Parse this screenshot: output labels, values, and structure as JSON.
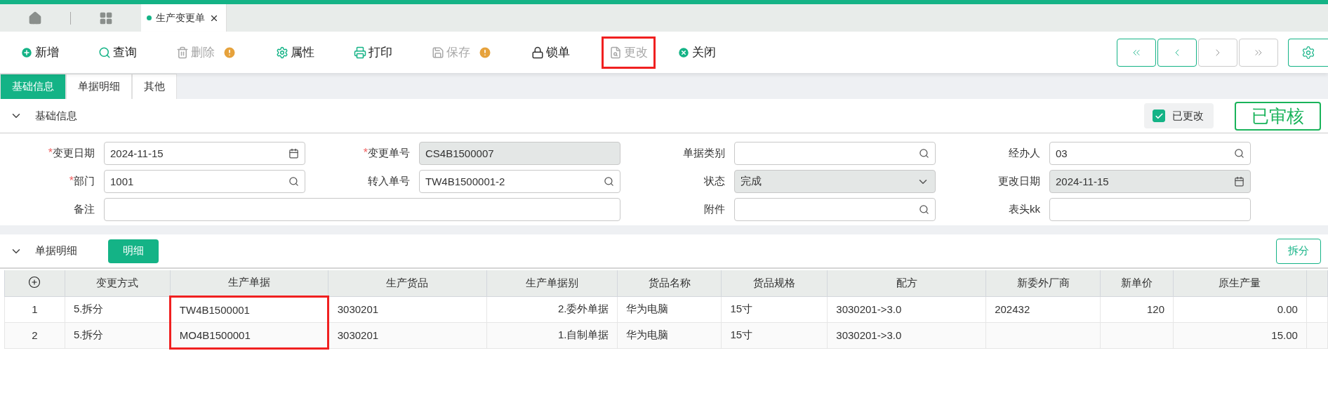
{
  "tabs": [
    {
      "label": "生产变更单",
      "selected": true
    }
  ],
  "toolbar": [
    {
      "label": "新增",
      "disabled": false,
      "warning": false,
      "highlighted": false
    },
    {
      "label": "查询",
      "disabled": false,
      "warning": false,
      "highlighted": false
    },
    {
      "label": "删除",
      "disabled": true,
      "warning": true,
      "highlighted": false
    },
    {
      "label": "属性",
      "disabled": false,
      "warning": false,
      "highlighted": false
    },
    {
      "label": "打印",
      "disabled": false,
      "warning": false,
      "highlighted": false
    },
    {
      "label": "保存",
      "disabled": true,
      "warning": true,
      "highlighted": false
    },
    {
      "label": "锁单",
      "disabled": false,
      "warning": false,
      "highlighted": false
    },
    {
      "label": "更改",
      "disabled": true,
      "warning": false,
      "highlighted": true
    },
    {
      "label": "关闭",
      "disabled": false,
      "warning": false,
      "highlighted": false
    }
  ],
  "nav_buttons": [
    {
      "disabled": false
    },
    {
      "disabled": false
    },
    {
      "disabled": true
    },
    {
      "disabled": true
    }
  ],
  "sub_tabs": [
    {
      "label": "基础信息",
      "selected": true
    },
    {
      "label": "单据明细",
      "selected": false
    },
    {
      "label": "其他",
      "selected": false
    }
  ],
  "basic_section": {
    "title": "基础信息",
    "expanded": true,
    "changed_checkbox": {
      "label": "已更改",
      "checked": true
    },
    "stamp": "已审核",
    "fields": [
      {
        "label": "变更日期",
        "required_mark": "*",
        "value": "2024-11-15",
        "kind": "date",
        "readonly": false,
        "wide": false
      },
      {
        "label": "变更单号",
        "required_mark": "*",
        "value": "CS4B1500007",
        "kind": "plain",
        "readonly": true,
        "wide": false
      },
      {
        "label": "单据类别",
        "kind": "search",
        "readonly": false,
        "wide": false
      },
      {
        "label": "经办人",
        "value": "03",
        "kind": "search",
        "readonly": false,
        "wide": false
      },
      {
        "label": "部门",
        "required_mark": "*",
        "value": "1001",
        "kind": "search",
        "readonly": false,
        "wide": false
      },
      {
        "label": "转入单号",
        "value": "TW4B1500001-2",
        "kind": "search",
        "readonly": false,
        "wide": false
      },
      {
        "label": "状态",
        "value": "完成",
        "kind": "select",
        "readonly": true,
        "wide": false
      },
      {
        "label": "更改日期",
        "value": "2024-11-15",
        "kind": "date",
        "readonly": true,
        "wide": false
      },
      {
        "label": "备注",
        "kind": "plain",
        "readonly": false,
        "wide": true
      },
      {
        "label": "附件",
        "kind": "search",
        "readonly": false,
        "wide": false
      },
      {
        "label": "表头kk",
        "kind": "plain",
        "readonly": false,
        "wide": false
      }
    ]
  },
  "detail_section": {
    "title": "单据明细",
    "expanded": true,
    "detail_button": "明细",
    "split_button": "拆分",
    "table": {
      "columns": [
        {
          "kind": "index",
          "highlighted": false
        },
        {
          "label": "变更方式",
          "kind": "start",
          "highlighted": false
        },
        {
          "label": "生产单据",
          "kind": "start",
          "highlighted": true
        },
        {
          "label": "生产货品",
          "kind": "start",
          "highlighted": false
        },
        {
          "label": "生产单据别",
          "kind": "end",
          "highlighted": false
        },
        {
          "label": "货品名称",
          "kind": "start",
          "highlighted": false
        },
        {
          "label": "货品规格",
          "kind": "start",
          "highlighted": false
        },
        {
          "label": "配方",
          "kind": "start",
          "highlighted": false
        },
        {
          "label": "新委外厂商",
          "kind": "start",
          "highlighted": false
        },
        {
          "label": "新单价",
          "kind": "end",
          "highlighted": false
        },
        {
          "label": "原生产量",
          "kind": "end",
          "highlighted": false
        }
      ],
      "rows": [
        [
          "1",
          "5.拆分",
          "TW4B1500001",
          "3030201",
          "2.委外单据",
          "华为电脑",
          "15寸",
          "3030201->3.0",
          "202432",
          "120",
          "0.00"
        ],
        [
          "2",
          "5.拆分",
          "MO4B1500001",
          "3030201",
          "1.自制单据",
          "华为电脑",
          "15寸",
          "3030201->3.0",
          "",
          "",
          "15.00"
        ]
      ]
    }
  }
}
